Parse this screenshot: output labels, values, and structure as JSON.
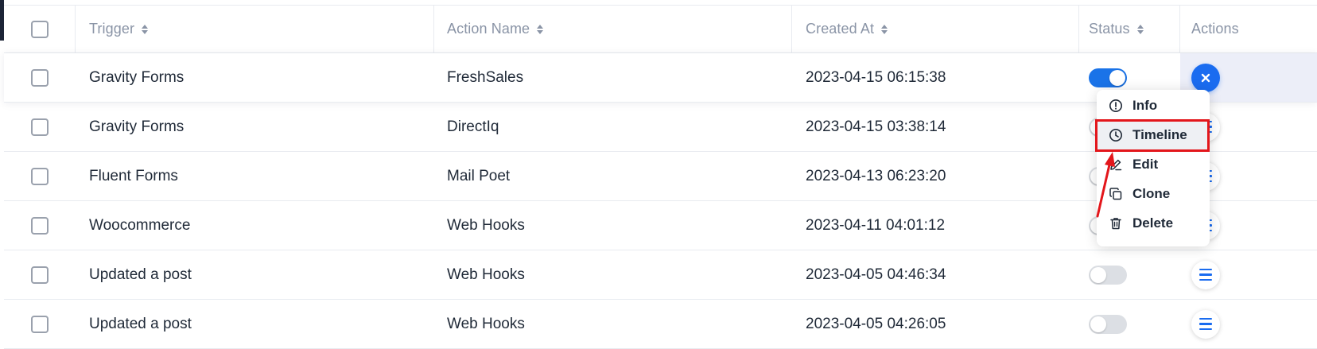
{
  "table": {
    "columns": [
      {
        "label": "Trigger",
        "sortable": true
      },
      {
        "label": "Action Name",
        "sortable": true
      },
      {
        "label": "Created At",
        "sortable": true
      },
      {
        "label": "Status",
        "sortable": true
      },
      {
        "label": "Actions",
        "sortable": false
      }
    ],
    "rows": [
      {
        "trigger": "Gravity Forms",
        "action": "FreshSales",
        "created": "2023-04-15 06:15:38",
        "status_on": true
      },
      {
        "trigger": "Gravity Forms",
        "action": "DirectIq",
        "created": "2023-04-15 03:38:14",
        "status_on": false
      },
      {
        "trigger": "Fluent Forms",
        "action": "Mail Poet",
        "created": "2023-04-13 06:23:20",
        "status_on": false
      },
      {
        "trigger": "Woocommerce",
        "action": "Web Hooks",
        "created": "2023-04-11 04:01:12",
        "status_on": false
      },
      {
        "trigger": "Updated a post",
        "action": "Web Hooks",
        "created": "2023-04-05 04:46:34",
        "status_on": false
      },
      {
        "trigger": "Updated a post",
        "action": "Web Hooks",
        "created": "2023-04-05 04:26:05",
        "status_on": false
      }
    ]
  },
  "menu": {
    "items": [
      {
        "label": "Info",
        "icon": "info-icon"
      },
      {
        "label": "Timeline",
        "icon": "clock-icon"
      },
      {
        "label": "Edit",
        "icon": "edit-icon"
      },
      {
        "label": "Clone",
        "icon": "copy-icon"
      },
      {
        "label": "Delete",
        "icon": "trash-icon"
      }
    ]
  },
  "colors": {
    "accent": "#1a6cf0",
    "annotation": "#e3161b",
    "header_text": "#8a94a6"
  }
}
